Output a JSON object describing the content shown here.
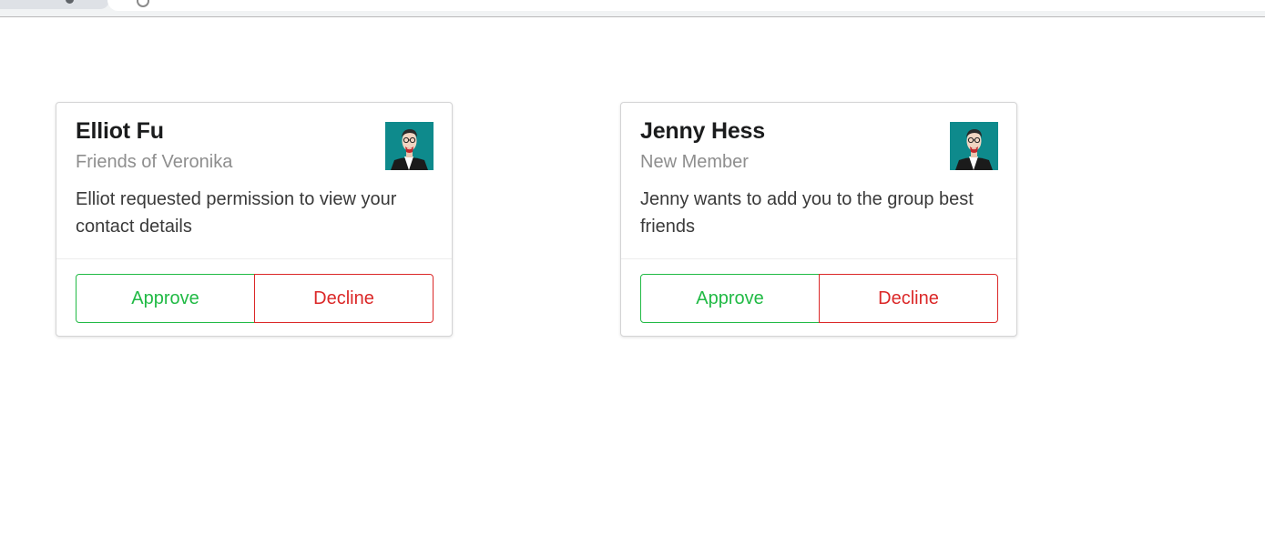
{
  "cards": [
    {
      "name": "Elliot Fu",
      "meta": "Friends of Veronika",
      "description": "Elliot requested permission to view your contact details",
      "approve_label": "Approve",
      "decline_label": "Decline"
    },
    {
      "name": "Jenny Hess",
      "meta": "New Member",
      "description": "Jenny wants to add you to the group best friends",
      "approve_label": "Approve",
      "decline_label": "Decline"
    }
  ],
  "colors": {
    "approve": "#21ba45",
    "decline": "#db2828",
    "avatar_bg": "#0e8a8c"
  }
}
